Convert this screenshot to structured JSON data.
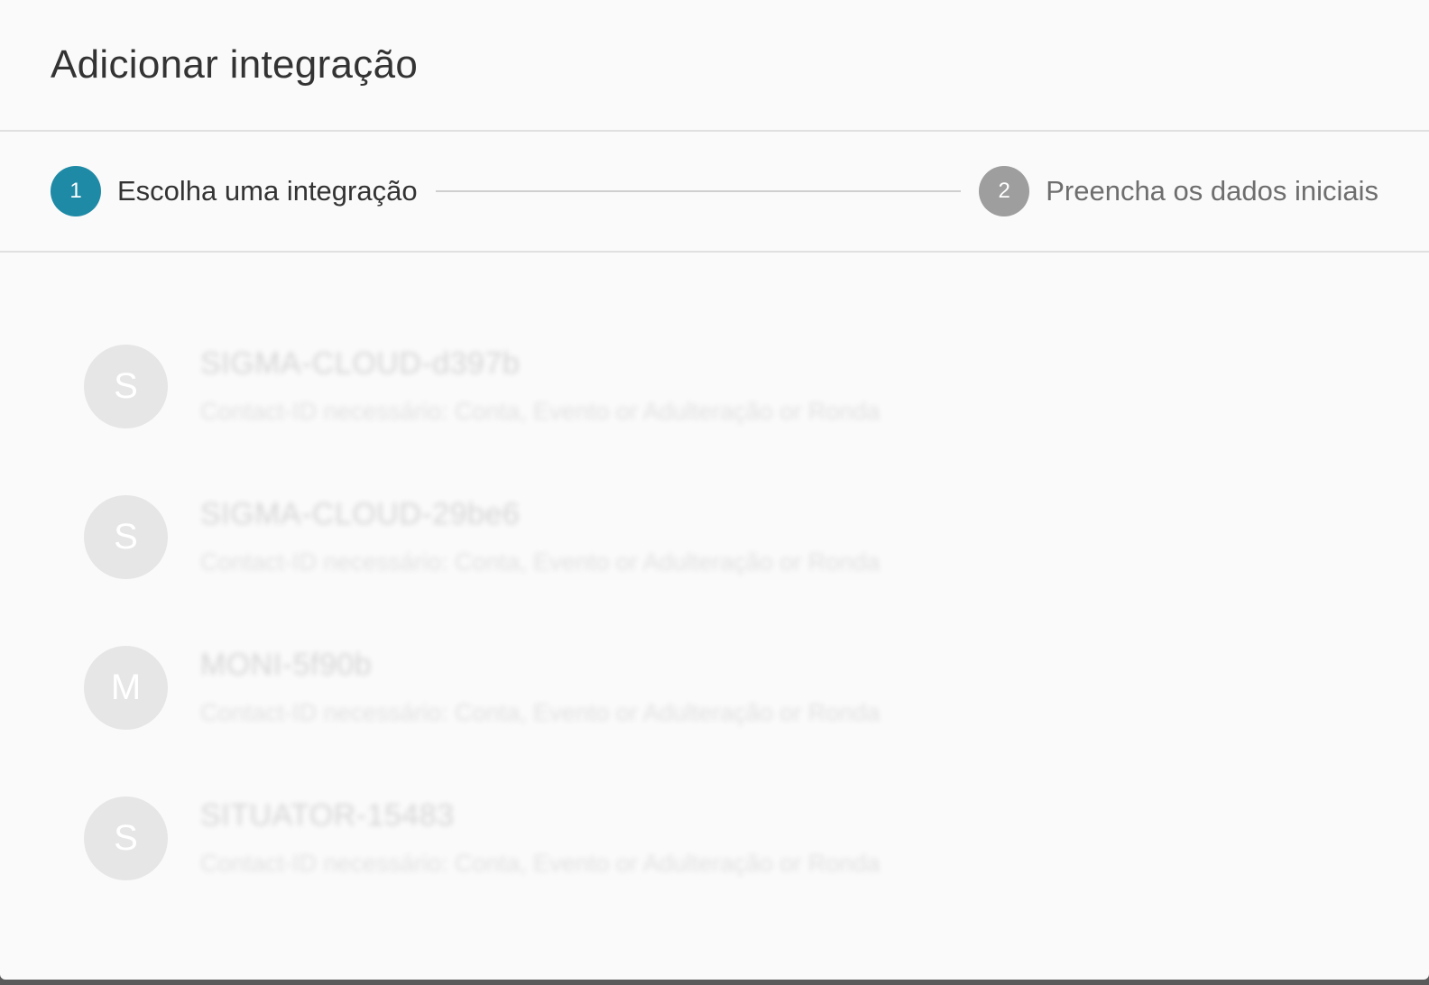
{
  "dialog": {
    "title": "Adicionar integração"
  },
  "stepper": {
    "steps": [
      {
        "number": "1",
        "label": "Escolha uma integração",
        "active": true
      },
      {
        "number": "2",
        "label": "Preencha os dados iniciais",
        "active": false
      }
    ],
    "colors": {
      "active": "#1f8aa6",
      "inactive": "#9e9e9e"
    }
  },
  "integrations": [
    {
      "initial": "S",
      "name": "SIGMA-CLOUD-d397b",
      "description": "Contact-ID necessário: Conta, Evento or Adulteração or Ronda"
    },
    {
      "initial": "S",
      "name": "SIGMA-CLOUD-29be6",
      "description": "Contact-ID necessário: Conta, Evento or Adulteração or Ronda"
    },
    {
      "initial": "M",
      "name": "MONI-5f90b",
      "description": "Contact-ID necessário: Conta, Evento or Adulteração or Ronda"
    },
    {
      "initial": "S",
      "name": "SITUATOR-15483",
      "description": "Contact-ID necessário: Conta, Evento or Adulteração or Ronda"
    }
  ]
}
